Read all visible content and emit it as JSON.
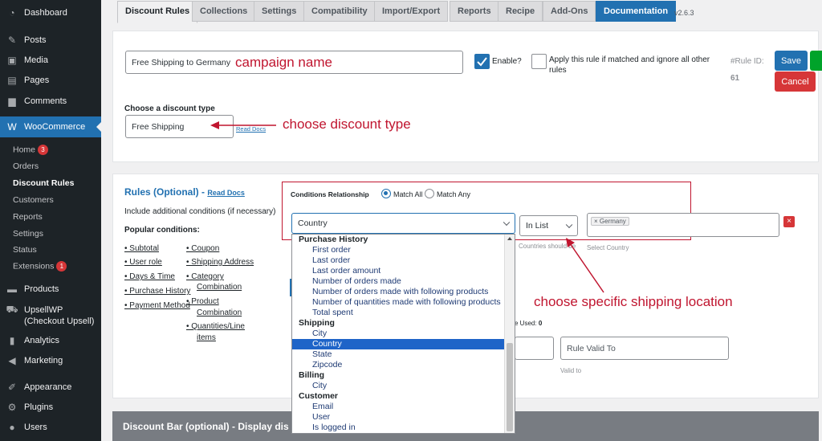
{
  "sidebar": {
    "items": [
      {
        "label": "Dashboard",
        "icon": "dashboard-icon",
        "glyph": "◔"
      },
      {
        "label": "Posts",
        "icon": "pin-icon",
        "glyph": "✎"
      },
      {
        "label": "Media",
        "icon": "media-icon",
        "glyph": "▣"
      },
      {
        "label": "Pages",
        "icon": "pages-icon",
        "glyph": "▤"
      },
      {
        "label": "Comments",
        "icon": "comments-icon",
        "glyph": "▆"
      }
    ],
    "woo": {
      "label": "WooCommerce",
      "icon": "woo-icon",
      "glyph": "W"
    },
    "sub": [
      {
        "label": "Home",
        "badge": "3"
      },
      {
        "label": "Orders",
        "badge": ""
      },
      {
        "label": "Discount Rules",
        "badge": ""
      },
      {
        "label": "Customers",
        "badge": ""
      },
      {
        "label": "Reports",
        "badge": ""
      },
      {
        "label": "Settings",
        "badge": ""
      },
      {
        "label": "Status",
        "badge": ""
      },
      {
        "label": "Extensions",
        "badge": "1"
      }
    ],
    "items2": [
      {
        "label": "Products",
        "icon": "products-icon",
        "glyph": "▬"
      },
      {
        "label": "UpsellWP",
        "icon": "cart-icon",
        "glyph": "⛟"
      },
      {
        "label": "(Checkout Upsell)",
        "icon": "",
        "glyph": ""
      },
      {
        "label": "Analytics",
        "icon": "analytics-icon",
        "glyph": "▮"
      },
      {
        "label": "Marketing",
        "icon": "marketing-icon",
        "glyph": "◀"
      },
      {
        "label": "Appearance",
        "icon": "brush-icon",
        "glyph": "✐"
      },
      {
        "label": "Plugins",
        "icon": "plugin-icon",
        "glyph": "⚙"
      },
      {
        "label": "Users",
        "icon": "users-icon",
        "glyph": "●"
      }
    ]
  },
  "tabs": [
    "Discount Rules",
    "Collections",
    "Settings",
    "Compatibility",
    "Import/Export",
    "Reports",
    "Recipe",
    "Add-Ons",
    "Documentation"
  ],
  "version": "v2.6.3",
  "rule": {
    "name_value": "Free Shipping to Germany",
    "enable_label": "Enable?",
    "apply_label_1": "Apply this rule if matched and ignore all other",
    "apply_label_2": "rules",
    "rule_id_label": "#Rule ID:",
    "rule_id_value": "61",
    "save": "Save",
    "cancel": "Cancel",
    "discount_type_heading": "Choose a discount type",
    "discount_type_value": "Free Shipping",
    "read_docs": "Read Docs"
  },
  "rules_section": {
    "title": "Rules (Optional) -",
    "read_docs": "Read Docs",
    "include_text": "Include additional conditions (if necessary)",
    "popular_heading": "Popular conditions:",
    "col1": [
      "Subtotal",
      "User role",
      "Days & Time",
      "Purchase History",
      "Payment Method"
    ],
    "col2": [
      "Coupon",
      "Shipping Address",
      "Category",
      "Combination",
      "Product",
      "Combination",
      "Quantities/Line",
      "items"
    ],
    "conditions_relationship": "Conditions Relationship",
    "match_all": "Match All",
    "match_any": "Match Any",
    "condition_type": "Country",
    "operator": "In List",
    "tag": "× Germany",
    "help_text": "Countries should be",
    "select_country": "Select Country",
    "used_text": "e Used:",
    "used_count": "0",
    "rule_valid_to": "Rule Valid To",
    "valid_to": "Valid to"
  },
  "dropdown": {
    "rows": [
      {
        "label": "Purchase History",
        "kind": "grp"
      },
      {
        "label": "First order",
        "kind": "opt"
      },
      {
        "label": "Last order",
        "kind": "opt"
      },
      {
        "label": "Last order amount",
        "kind": "opt"
      },
      {
        "label": "Number of orders made",
        "kind": "opt"
      },
      {
        "label": "Number of orders made with following products",
        "kind": "opt"
      },
      {
        "label": "Number of quantities made with following products",
        "kind": "opt"
      },
      {
        "label": "Total spent",
        "kind": "opt"
      },
      {
        "label": "Shipping",
        "kind": "grp"
      },
      {
        "label": "City",
        "kind": "opt"
      },
      {
        "label": "Country",
        "kind": "opt sel"
      },
      {
        "label": "State",
        "kind": "opt"
      },
      {
        "label": "Zipcode",
        "kind": "opt"
      },
      {
        "label": "Billing",
        "kind": "grp"
      },
      {
        "label": "City",
        "kind": "opt"
      },
      {
        "label": "Customer",
        "kind": "grp"
      },
      {
        "label": "Email",
        "kind": "opt"
      },
      {
        "label": "User",
        "kind": "opt"
      },
      {
        "label": "Is logged in",
        "kind": "opt"
      }
    ]
  },
  "discount_bar": {
    "title": "Discount Bar (optional) - Display dis"
  },
  "annotations": {
    "campaign": "campaign name",
    "discount_type": "choose discount type",
    "shipping_location": "choose specific shipping location"
  },
  "colors": {
    "accent": "#2271b1",
    "annotation": "#c0152f",
    "cancel": "#d63638"
  }
}
